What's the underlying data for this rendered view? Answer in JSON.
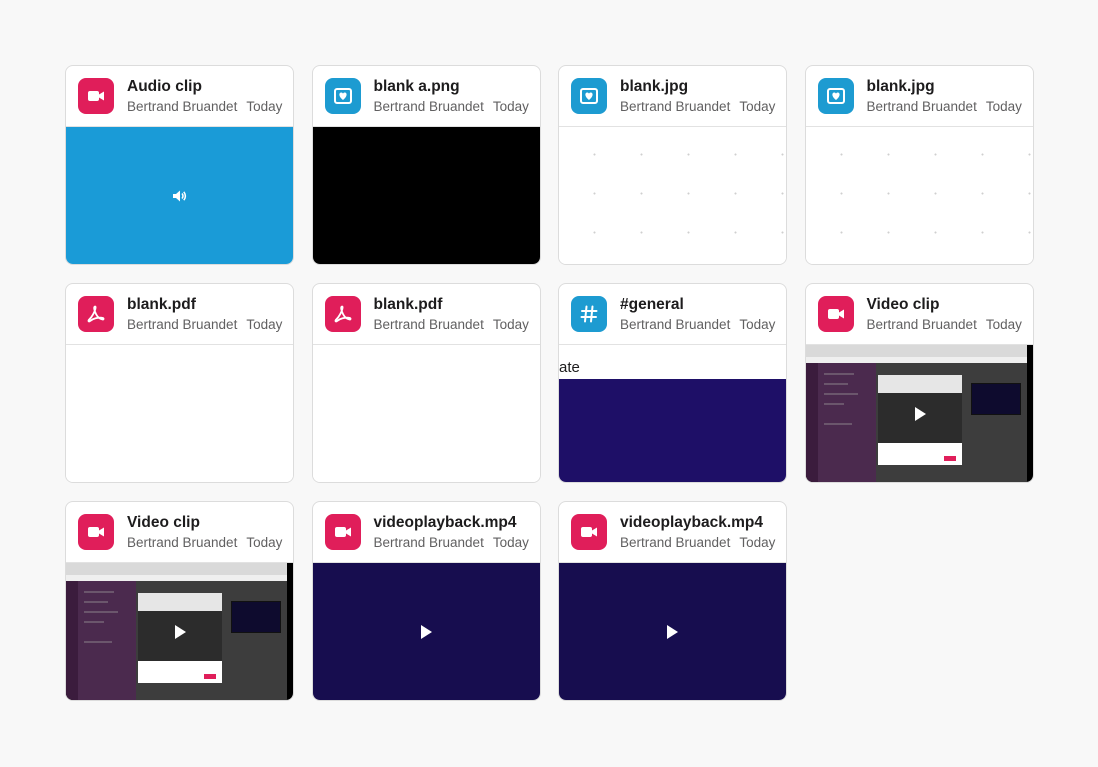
{
  "files": [
    {
      "title": "Audio clip",
      "author": "Bertrand Bruandet",
      "date": "Today",
      "icon": "video-icon",
      "icon_color": "#e01e5a",
      "preview": "audio"
    },
    {
      "title": "blank a.png",
      "author": "Bertrand Bruandet",
      "date": "Today",
      "icon": "image-icon",
      "icon_color": "#1d9bd1",
      "preview": "black"
    },
    {
      "title": "blank.jpg",
      "author": "Bertrand Bruandet",
      "date": "Today",
      "icon": "image-icon",
      "icon_color": "#1d9bd1",
      "preview": "dots"
    },
    {
      "title": "blank.jpg",
      "author": "Bertrand Bruandet",
      "date": "Today",
      "icon": "image-icon",
      "icon_color": "#1d9bd1",
      "preview": "dots"
    },
    {
      "title": "blank.pdf",
      "author": "Bertrand Bruandet",
      "date": "Today",
      "icon": "pdf-icon",
      "icon_color": "#e01e5a",
      "preview": "white"
    },
    {
      "title": "blank.pdf",
      "author": "Bertrand Bruandet",
      "date": "Today",
      "icon": "pdf-icon",
      "icon_color": "#e01e5a",
      "preview": "white"
    },
    {
      "title": "#general",
      "author": "Bertrand Bruandet",
      "date": "Today",
      "icon": "hash-icon",
      "icon_color": "#1d9bd1",
      "preview": "channel",
      "preview_text": "ate"
    },
    {
      "title": "Video clip",
      "author": "Bertrand Bruandet",
      "date": "Today",
      "icon": "video-icon",
      "icon_color": "#e01e5a",
      "preview": "screenshot"
    },
    {
      "title": "Video clip",
      "author": "Bertrand Bruandet",
      "date": "Today",
      "icon": "video-icon",
      "icon_color": "#e01e5a",
      "preview": "screenshot"
    },
    {
      "title": "videoplayback.mp4",
      "author": "Bertrand Bruandet",
      "date": "Today",
      "icon": "video-icon",
      "icon_color": "#e01e5a",
      "preview": "navy"
    },
    {
      "title": "videoplayback.mp4",
      "author": "Bertrand Bruandet",
      "date": "Today",
      "icon": "video-icon",
      "icon_color": "#e01e5a",
      "preview": "navy"
    }
  ]
}
